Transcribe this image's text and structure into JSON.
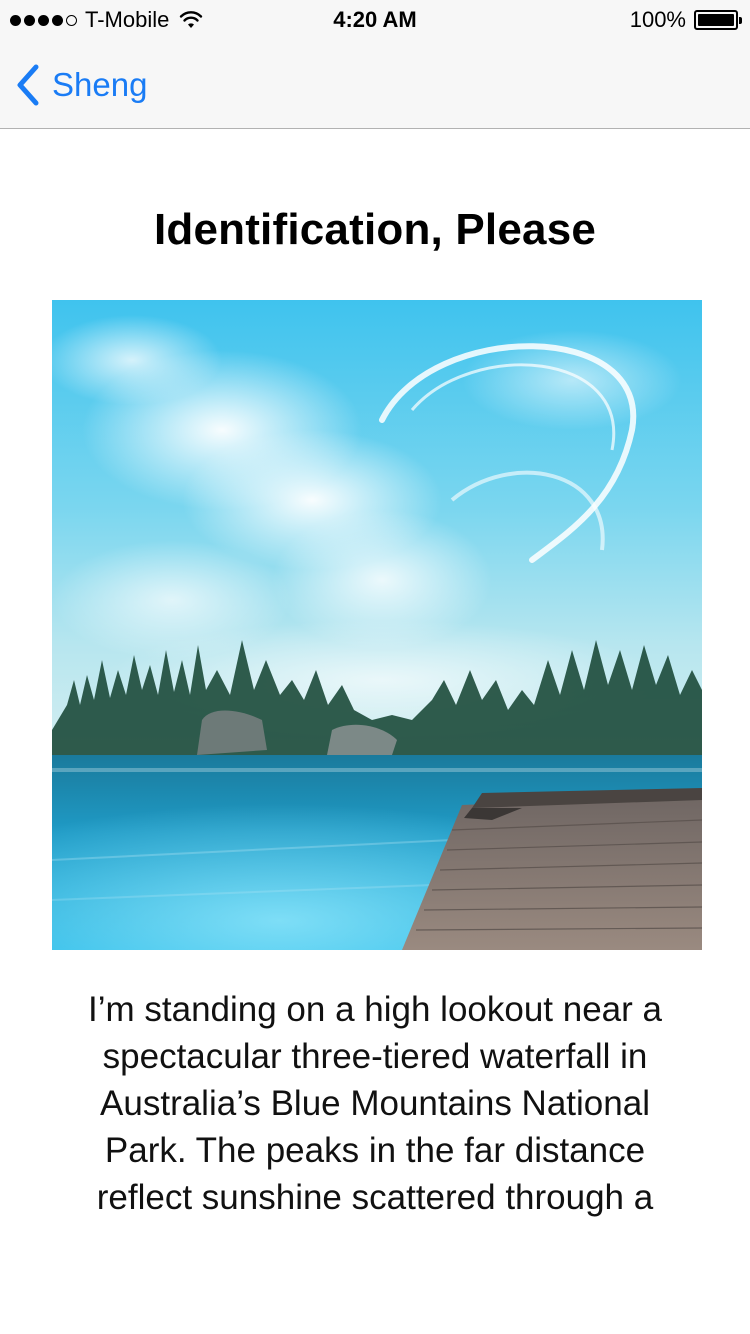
{
  "status_bar": {
    "carrier": "T-Mobile",
    "signal_bars_filled": 4,
    "signal_bars_total": 5,
    "time": "4:20 AM",
    "battery_percent": "100%",
    "battery_level": 1.0,
    "wifi_icon": "wifi-icon"
  },
  "nav": {
    "back_label": "Sheng",
    "back_icon": "chevron-left-icon",
    "accent_color": "#1a7cf5"
  },
  "content": {
    "title": "Identification, Please",
    "image_subject": "lake-landscape",
    "description": "I’m standing on a high lookout near a spectacular three-tiered waterfall in Australia’s Blue Mountains National Park. The peaks in the far distance reflect sunshine scattered through a"
  }
}
